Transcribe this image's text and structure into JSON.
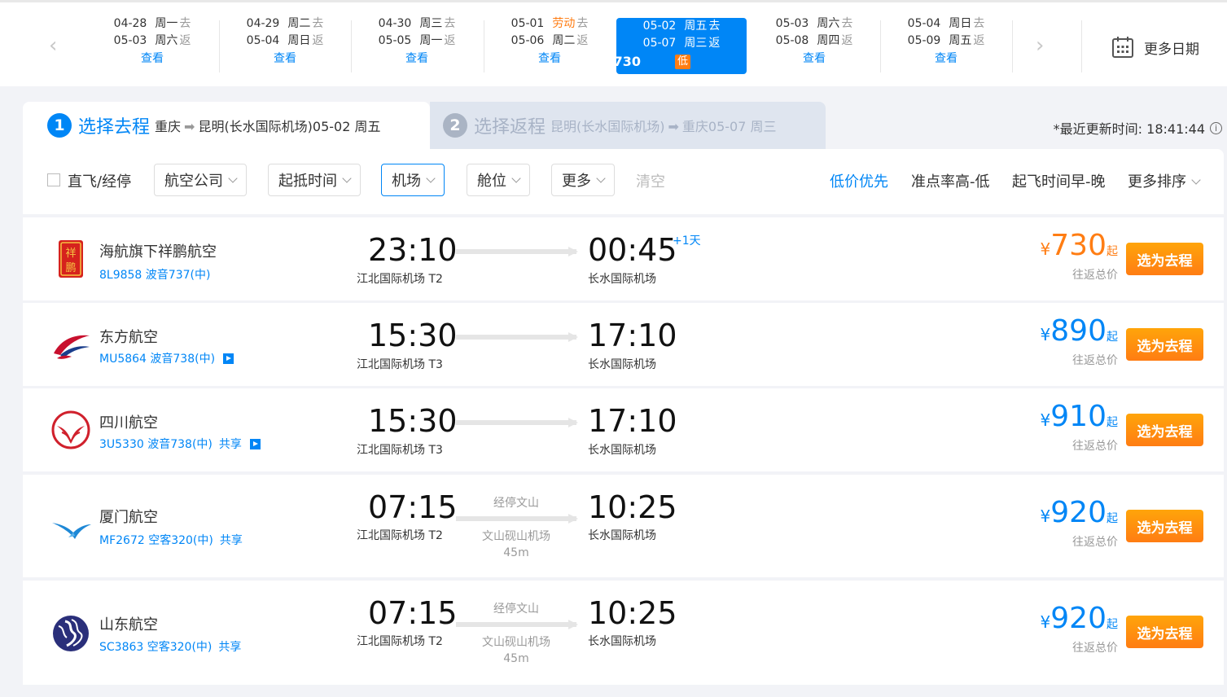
{
  "date_strip": {
    "prev_arrow": "‹",
    "next_arrow": "›",
    "items": [
      {
        "dep_date": "04-28",
        "dep_dow": "周一",
        "dep_tag": "去",
        "ret_date": "05-03",
        "ret_dow": "周六",
        "ret_tag": "返",
        "action": "查看"
      },
      {
        "dep_date": "04-29",
        "dep_dow": "周二",
        "dep_tag": "去",
        "ret_date": "05-04",
        "ret_dow": "周日",
        "ret_tag": "返",
        "action": "查看"
      },
      {
        "dep_date": "04-30",
        "dep_dow": "周三",
        "dep_tag": "去",
        "ret_date": "05-05",
        "ret_dow": "周一",
        "ret_tag": "返",
        "action": "查看"
      },
      {
        "dep_date": "05-01",
        "dep_dow": "劳动",
        "dep_tag": "去",
        "ret_date": "05-06",
        "ret_dow": "周二",
        "ret_tag": "返",
        "action": "查看"
      },
      {
        "dep_date": "05-02",
        "dep_dow": "周五",
        "dep_tag": "去",
        "ret_date": "05-07",
        "ret_dow": "周三",
        "ret_tag": "返",
        "price": "¥730",
        "low": "低"
      },
      {
        "dep_date": "05-03",
        "dep_dow": "周六",
        "dep_tag": "去",
        "ret_date": "05-08",
        "ret_dow": "周四",
        "ret_tag": "返",
        "action": "查看"
      },
      {
        "dep_date": "05-04",
        "dep_dow": "周日",
        "dep_tag": "去",
        "ret_date": "05-09",
        "ret_dow": "周五",
        "ret_tag": "返",
        "action": "查看"
      }
    ],
    "more_dates": "更多日期"
  },
  "legs": {
    "outbound": {
      "step": "1",
      "title": "选择去程",
      "from": "重庆",
      "arrow": "➡",
      "to": "昆明(长水国际机场)05-02 周五"
    },
    "return": {
      "step": "2",
      "title": "选择返程",
      "from": "昆明(长水国际机场)",
      "arrow": "➡",
      "to": "重庆05-07 周三"
    },
    "update_time": "*最近更新时间: 18:41:44",
    "info_icon": "i"
  },
  "filters": {
    "direct": "直飞/经停",
    "airline": "航空公司",
    "time": "起抵时间",
    "airport": "机场",
    "cabin": "舱位",
    "more": "更多",
    "clear": "清空",
    "sort_price": "低价优先",
    "sort_ontime": "准点率高-低",
    "sort_dep": "起飞时间早-晚",
    "sort_more": "更多排序"
  },
  "flights": [
    {
      "airline": "海航旗下祥鹏航空",
      "flight_no": "8L9858 波音737(中)",
      "share": "",
      "dep_time": "23:10",
      "dep_airport": "江北国际机场 T2",
      "arr_time": "00:45",
      "arr_airport": "长水国际机场",
      "plus_day": "+1天",
      "yen": "¥",
      "price": "730",
      "qi": "起",
      "price_note": "往返总价",
      "button": "选为去程"
    },
    {
      "airline": "东方航空",
      "flight_no": "MU5864 波音738(中)",
      "share": "",
      "dep_time": "15:30",
      "dep_airport": "江北国际机场 T3",
      "arr_time": "17:10",
      "arr_airport": "长水国际机场",
      "yen": "¥",
      "price": "890",
      "qi": "起",
      "price_note": "往返总价",
      "button": "选为去程"
    },
    {
      "airline": "四川航空",
      "flight_no": "3U5330 波音738(中)",
      "share": "共享",
      "dep_time": "15:30",
      "dep_airport": "江北国际机场 T3",
      "arr_time": "17:10",
      "arr_airport": "长水国际机场",
      "yen": "¥",
      "price": "910",
      "qi": "起",
      "price_note": "往返总价",
      "button": "选为去程"
    },
    {
      "airline": "厦门航空",
      "flight_no": "MF2672 空客320(中)",
      "share": "共享",
      "dep_time": "07:15",
      "dep_airport": "江北国际机场 T2",
      "arr_time": "10:25",
      "arr_airport": "长水国际机场",
      "stop_label": "经停文山",
      "stop_airport": "文山砚山机场",
      "stop_duration": "45m",
      "yen": "¥",
      "price": "920",
      "qi": "起",
      "price_note": "往返总价",
      "button": "选为去程"
    },
    {
      "airline": "山东航空",
      "flight_no": "SC3863 空客320(中)",
      "share": "共享",
      "dep_time": "07:15",
      "dep_airport": "江北国际机场 T2",
      "arr_time": "10:25",
      "arr_airport": "长水国际机场",
      "stop_label": "经停文山",
      "stop_airport": "文山砚山机场",
      "stop_duration": "45m",
      "yen": "¥",
      "price": "920",
      "qi": "起",
      "price_note": "往返总价",
      "button": "选为去程"
    }
  ],
  "colors": {
    "accent": "#0086f6",
    "orange": "#ff7d13"
  }
}
